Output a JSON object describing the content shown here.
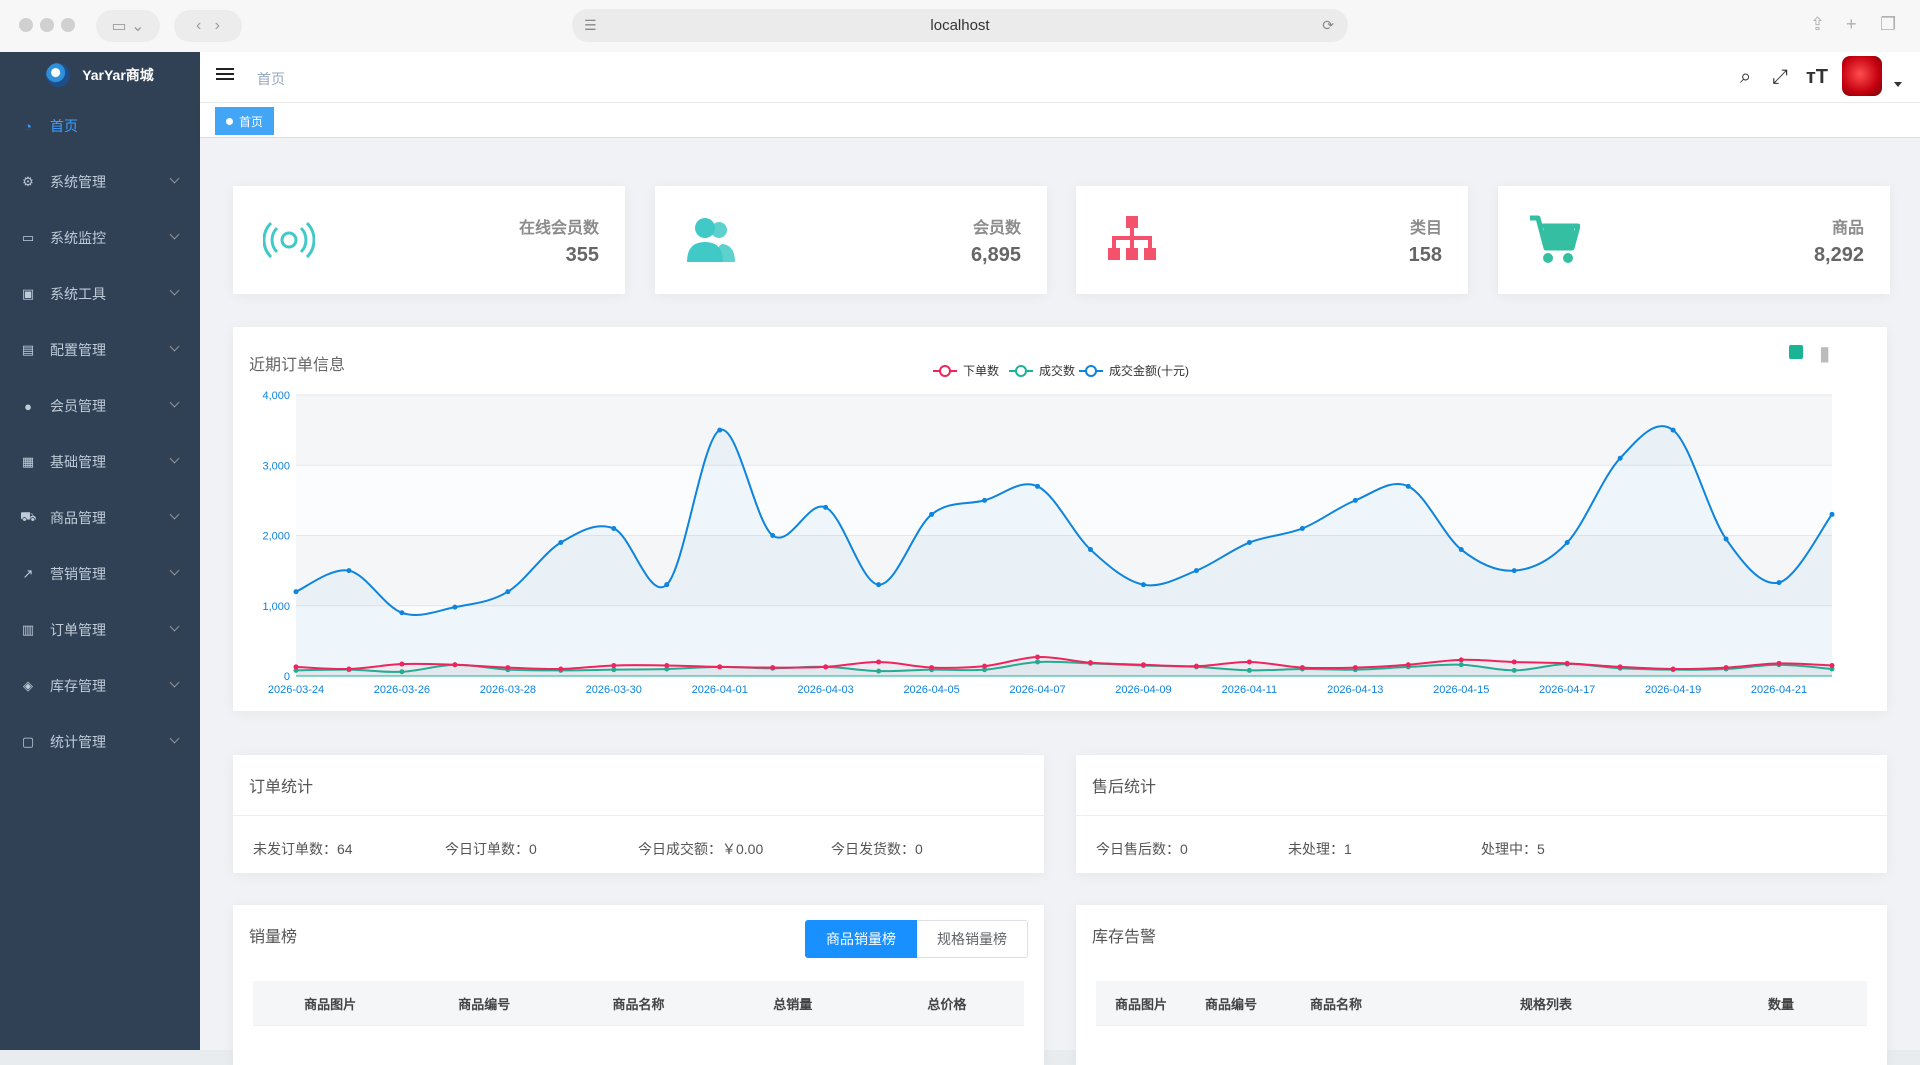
{
  "browser": {
    "address": "localhost"
  },
  "brand": {
    "name": "YarYar商城"
  },
  "sidebar": {
    "items": [
      {
        "label": "首页",
        "icon": "dashboard-icon",
        "active": true
      },
      {
        "label": "系统管理",
        "icon": "gear-icon"
      },
      {
        "label": "系统监控",
        "icon": "monitor-icon"
      },
      {
        "label": "系统工具",
        "icon": "toolbox-icon"
      },
      {
        "label": "配置管理",
        "icon": "config-icon"
      },
      {
        "label": "会员管理",
        "icon": "user-icon"
      },
      {
        "label": "基础管理",
        "icon": "base-icon"
      },
      {
        "label": "商品管理",
        "icon": "cart-icon"
      },
      {
        "label": "营销管理",
        "icon": "external-link-icon"
      },
      {
        "label": "订单管理",
        "icon": "order-icon"
      },
      {
        "label": "库存管理",
        "icon": "layers-icon"
      },
      {
        "label": "统计管理",
        "icon": "stats-icon"
      }
    ]
  },
  "navbar": {
    "breadcrumb": "首页"
  },
  "tags": {
    "active": "首页"
  },
  "stats": [
    {
      "label": "在线会员数",
      "value": "355",
      "icon": "online-member-icon",
      "color": "#40c9c6"
    },
    {
      "label": "会员数",
      "value": "6,895",
      "icon": "members-icon",
      "color": "#40c9c6"
    },
    {
      "label": "类目",
      "value": "158",
      "icon": "category-tree-icon",
      "color": "#f4516c"
    },
    {
      "label": "商品",
      "value": "8,292",
      "icon": "cart-icon",
      "color": "#34bfa3"
    }
  ],
  "chart_panel": {
    "title": "近期订单信息"
  },
  "chart_data": {
    "type": "line",
    "smooth": true,
    "title": "",
    "x": [
      "2026-03-24",
      "2026-03-25",
      "2026-03-26",
      "2026-03-27",
      "2026-03-28",
      "2026-03-29",
      "2026-03-30",
      "2026-03-31",
      "2026-04-01",
      "2026-04-02",
      "2026-04-03",
      "2026-04-04",
      "2026-04-05",
      "2026-04-06",
      "2026-04-07",
      "2026-04-08",
      "2026-04-09",
      "2026-04-10",
      "2026-04-11",
      "2026-04-12",
      "2026-04-13",
      "2026-04-14",
      "2026-04-15",
      "2026-04-16",
      "2026-04-17",
      "2026-04-18",
      "2026-04-19",
      "2026-04-20",
      "2026-04-21",
      "2026-04-22"
    ],
    "x_tick_labels": [
      "2026-03-24",
      "2026-03-26",
      "2026-03-28",
      "2026-03-30",
      "2026-04-01",
      "2026-04-03",
      "2026-04-05",
      "2026-04-07",
      "2026-04-09",
      "2026-04-11",
      "2026-04-13",
      "2026-04-15",
      "2026-04-17",
      "2026-04-19",
      "2026-04-21"
    ],
    "ylim": [
      0,
      4000
    ],
    "y_ticks": [
      0,
      1000,
      2000,
      3000,
      4000
    ],
    "y_tick_labels": [
      "0",
      "1,000",
      "2,000",
      "3,000",
      "4,000"
    ],
    "legend": "top-center",
    "series": [
      {
        "name": "下单数",
        "color": "#f0245c",
        "values": [
          130,
          100,
          170,
          160,
          120,
          100,
          150,
          150,
          130,
          120,
          130,
          200,
          120,
          140,
          270,
          190,
          160,
          140,
          200,
          120,
          120,
          160,
          230,
          200,
          180,
          130,
          100,
          120,
          180,
          150
        ]
      },
      {
        "name": "成交数",
        "color": "#1ab394",
        "values": [
          80,
          90,
          60,
          160,
          90,
          80,
          90,
          100,
          130,
          110,
          130,
          70,
          90,
          90,
          200,
          180,
          150,
          130,
          80,
          100,
          90,
          130,
          160,
          80,
          170,
          110,
          90,
          100,
          160,
          100
        ]
      },
      {
        "name": "成交金额(十元)",
        "color": "#0d84dd",
        "values": [
          1200,
          1500,
          900,
          980,
          1200,
          1900,
          2100,
          1300,
          3500,
          2000,
          2400,
          1300,
          2300,
          2500,
          2700,
          1800,
          1300,
          1500,
          1900,
          2100,
          2500,
          2700,
          1800,
          1500,
          1900,
          3100,
          3500,
          1950,
          1330,
          2300
        ]
      }
    ]
  },
  "order_stats": {
    "title": "订单统计",
    "items": [
      {
        "label": "未发订单数：",
        "value": "64"
      },
      {
        "label": "今日订单数：",
        "value": "0"
      },
      {
        "label": "今日成交额：",
        "value": "￥0.00"
      },
      {
        "label": "今日发货数：",
        "value": "0"
      }
    ]
  },
  "aftersale_stats": {
    "title": "售后统计",
    "items": [
      {
        "label": "今日售后数：",
        "value": "0"
      },
      {
        "label": "未处理：",
        "value": "1"
      },
      {
        "label": "处理中：",
        "value": "5"
      }
    ]
  },
  "sales_rank": {
    "title": "销量榜",
    "tabs": [
      "商品销量榜",
      "规格销量榜"
    ],
    "columns": [
      "商品图片",
      "商品编号",
      "商品名称",
      "总销量",
      "总价格"
    ]
  },
  "stock_alert": {
    "title": "库存告警",
    "columns": [
      "商品图片",
      "商品编号",
      "商品名称",
      "规格列表",
      "数量"
    ]
  }
}
